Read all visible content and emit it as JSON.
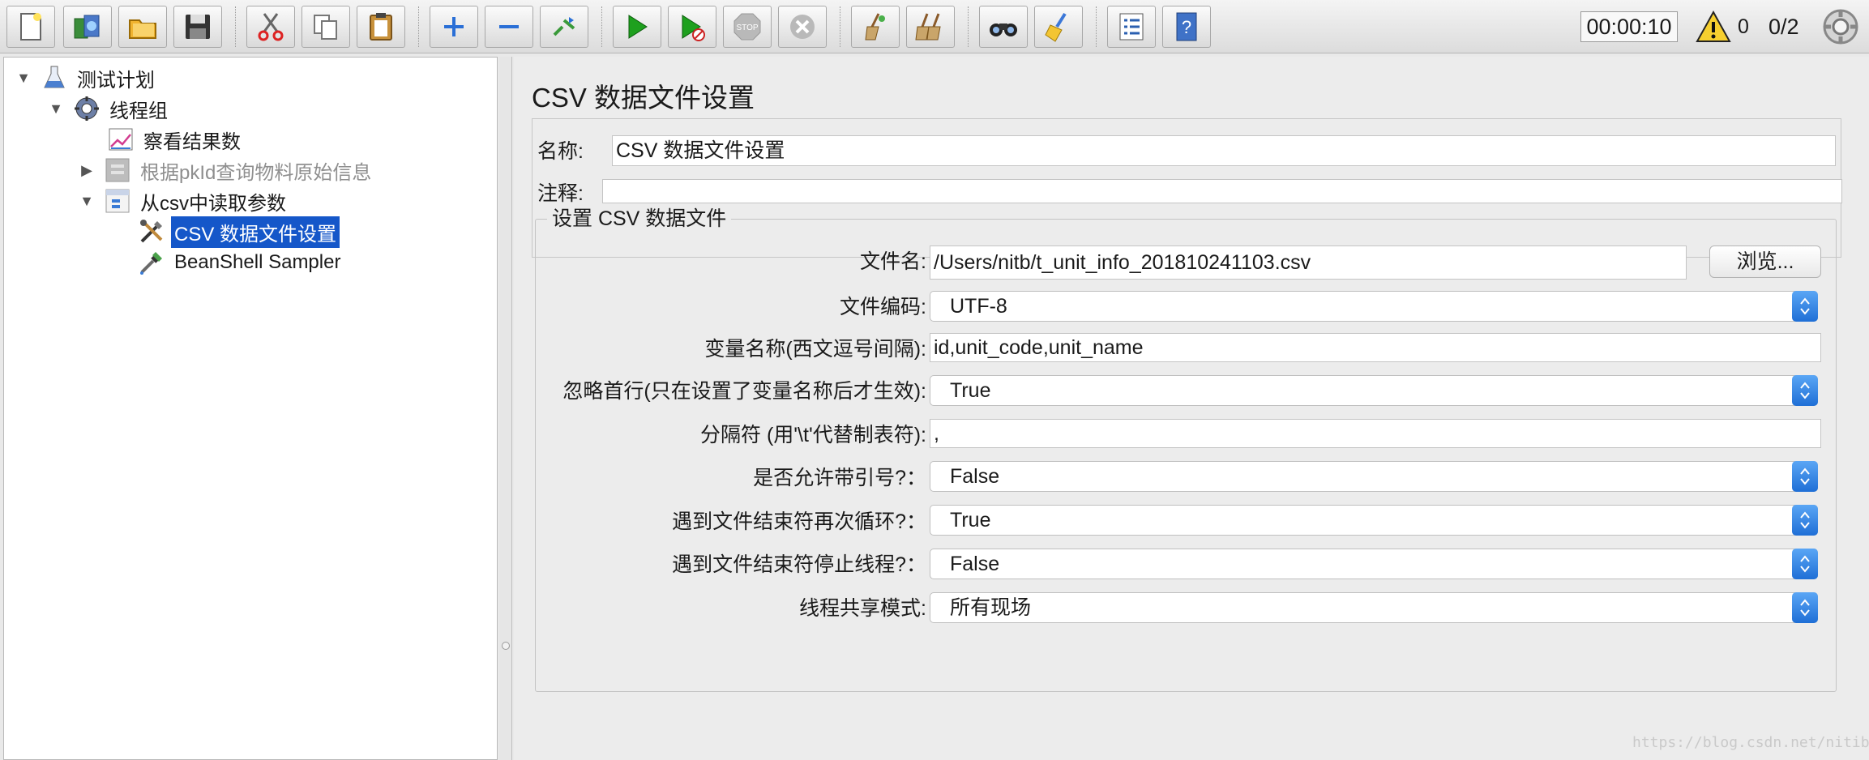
{
  "toolbar": {
    "buttons": [
      {
        "name": "new-icon"
      },
      {
        "name": "templates-icon"
      },
      {
        "name": "open-icon"
      },
      {
        "name": "save-icon"
      },
      {
        "name": "cut-icon"
      },
      {
        "name": "copy-icon"
      },
      {
        "name": "paste-icon"
      },
      {
        "name": "expand-icon"
      },
      {
        "name": "collapse-icon"
      },
      {
        "name": "toggle-icon"
      },
      {
        "name": "start-icon"
      },
      {
        "name": "start-no-pause-icon"
      },
      {
        "name": "stop-icon"
      },
      {
        "name": "shutdown-icon"
      },
      {
        "name": "clear-icon"
      },
      {
        "name": "clear-all-icon"
      },
      {
        "name": "search-icon"
      },
      {
        "name": "reset-search-icon"
      },
      {
        "name": "function-helper-icon"
      },
      {
        "name": "help-icon"
      }
    ],
    "stop_label": "STOP",
    "elapsed": "00:00:10",
    "warning_count": "0",
    "threads": "0/2",
    "accent": "#1557c9"
  },
  "tree": {
    "items": [
      {
        "label": "测试计划",
        "icon": "flask-icon",
        "expanded": true
      },
      {
        "label": "线程组",
        "icon": "gear-icon",
        "expanded": true
      },
      {
        "label": "察看结果数",
        "icon": "chart-icon"
      },
      {
        "label": "根据pkId查询物料原始信息",
        "icon": "controller-icon",
        "expanded": false,
        "disabled": true
      },
      {
        "label": "从csv中读取参数",
        "icon": "controller-icon",
        "expanded": true
      },
      {
        "label": "CSV 数据文件设置",
        "icon": "tools-icon",
        "selected": true
      },
      {
        "label": "BeanShell Sampler",
        "icon": "pipette-icon"
      }
    ]
  },
  "panel": {
    "title": "CSV 数据文件设置",
    "name_label": "名称:",
    "name_value": "CSV 数据文件设置",
    "comment_label": "注释:",
    "comment_value": "",
    "group_title": "设置 CSV 数据文件",
    "filename_label": "文件名:",
    "filename_value": "/Users/nitb/t_unit_info_201810241103.csv",
    "browse_label": "浏览...",
    "encoding_label": "文件编码:",
    "encoding_value": "UTF-8",
    "varnames_label": "变量名称(西文逗号间隔):",
    "varnames_value": "id,unit_code,unit_name",
    "ignore_first_label": "忽略首行(只在设置了变量名称后才生效):",
    "ignore_first_value": "True",
    "delimiter_label": "分隔符 (用'\\t'代替制表符):",
    "delimiter_value": ",",
    "quoted_label": "是否允许带引号?：",
    "quoted_value": "False",
    "recycle_label": "遇到文件结束符再次循环?：",
    "recycle_value": "True",
    "stop_thread_label": "遇到文件结束符停止线程?：",
    "stop_thread_value": "False",
    "sharing_label": "线程共享模式:",
    "sharing_value": "所有现场"
  },
  "watermark": "https://blog.csdn.net/nitibu"
}
